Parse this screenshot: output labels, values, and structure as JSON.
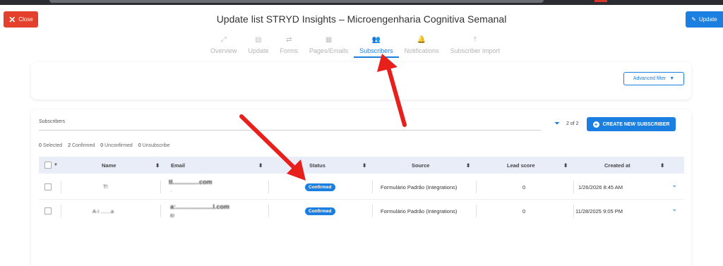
{
  "header": {
    "close_label": "Close",
    "title": "Update list STRYD Insights – Microengenharia Cognitiva Semanal",
    "update_label": "Update"
  },
  "tabs": [
    {
      "label": "Overview",
      "icon": "chart-line-icon"
    },
    {
      "label": "Update",
      "icon": "document-icon"
    },
    {
      "label": "Forms",
      "icon": "shuffle-icon"
    },
    {
      "label": "Pages/Emails",
      "icon": "grid-icon"
    },
    {
      "label": "Subscribers",
      "icon": "users-icon",
      "active": true
    },
    {
      "label": "Notifications",
      "icon": "bell-icon"
    },
    {
      "label": "Subscriber import",
      "icon": "upload-icon"
    }
  ],
  "filters": {
    "advanced_filter_label": "Advanced filter"
  },
  "subscribers": {
    "search_label": "Subscribers",
    "count": "2 of 2",
    "create_label": "CREATE NEW SUBSCRIBER",
    "stats": {
      "selected": "0",
      "selected_label": "Selected",
      "confirmed": "2",
      "confirmed_label": "Confirmed",
      "unconfirmed": "0",
      "unconfirmed_label": "Unconfirmed",
      "unsubscribe": "0",
      "unsubscribe_label": "Unsubscribe"
    },
    "columns": {
      "name": "Name",
      "email": "Email",
      "status": "Status",
      "source": "Source",
      "lead_score": "Lead score",
      "created_at": "Created at"
    },
    "rows": [
      {
        "name": "T!",
        "email": "tl...............com",
        "email2": "·",
        "status": "Confirmed",
        "source": "Formulário Padrão (Integrations)",
        "lead_score": "0",
        "created_at": "1/26/2026 8:45 AM"
      },
      {
        "name": "A·i .......a",
        "email": "a:.....................l.com",
        "email2": "6!",
        "status": "Confirmed",
        "source": "Formulário Padrão (Integrations)",
        "lead_score": "0",
        "created_at": "11/28/2025 9:05 PM"
      }
    ]
  },
  "colors": {
    "accent": "#1a7fe0",
    "close": "#e3412b",
    "annotation_arrow": "#e8201c"
  }
}
